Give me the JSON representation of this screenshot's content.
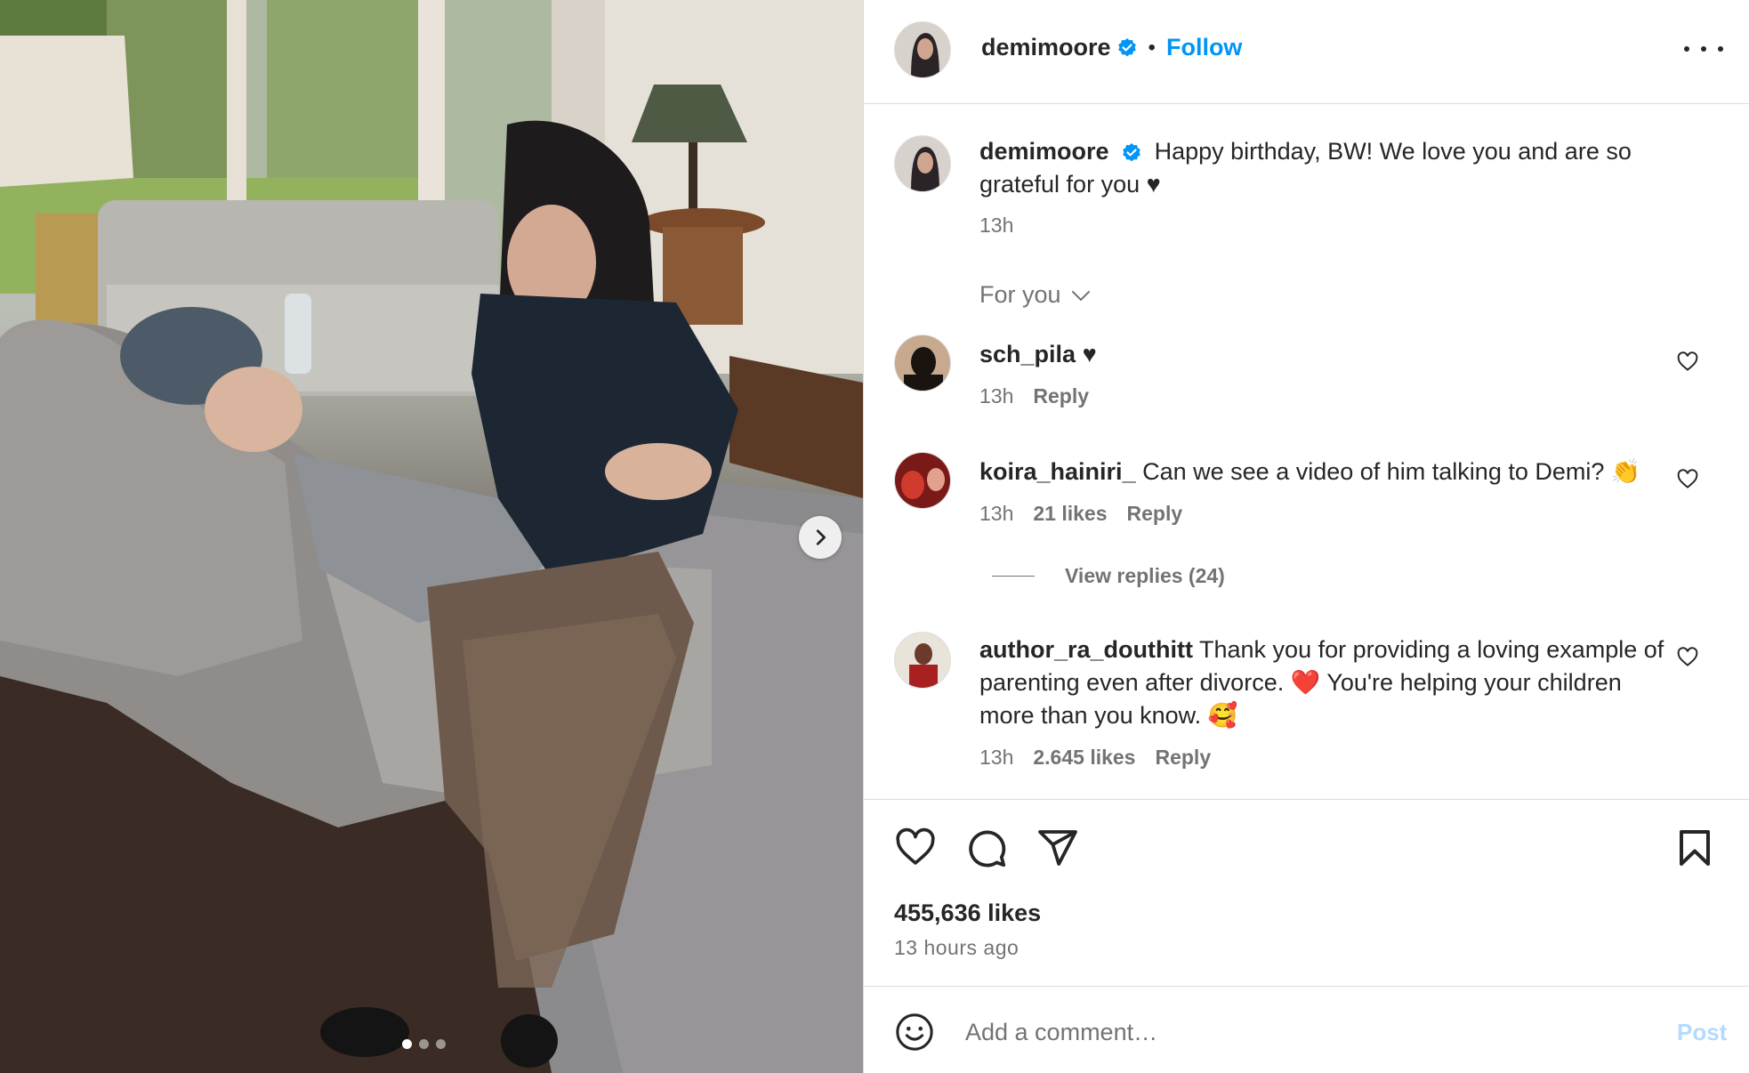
{
  "header": {
    "username": "demimoore",
    "separator": "•",
    "follow_label": "Follow"
  },
  "caption": {
    "username": "demimoore",
    "text": "Happy birthday, BW! We love you and are so grateful for you ♥",
    "time": "13h"
  },
  "filter": {
    "label": "For you"
  },
  "comments": [
    {
      "username": "sch_pila",
      "text": "♥",
      "time": "13h",
      "likes": "",
      "reply": "Reply"
    },
    {
      "username": "koira_hainiri_",
      "text": "Can we see a video of him talking to Demi? 👏",
      "time": "13h",
      "likes": "21 likes",
      "reply": "Reply",
      "view_replies": "View replies (24)"
    },
    {
      "username": "author_ra_douthitt",
      "text": "Thank you for providing a loving example of parenting even after divorce. ❤️ You're helping your children more than you know. 🥰",
      "time": "13h",
      "likes": "2.645 likes",
      "reply": "Reply"
    }
  ],
  "stats": {
    "likes": "455,636 likes",
    "time_ago": "13 hours ago"
  },
  "composer": {
    "placeholder": "Add a comment…",
    "post_label": "Post"
  },
  "carousel": {
    "slide_count": 3,
    "active_index": 0
  },
  "colors": {
    "accent": "#0095f6",
    "verified": "#0095f6",
    "post_disabled": "#b3dbff",
    "text": "#262626",
    "muted": "#737373"
  },
  "icons": [
    "chevron-right-icon",
    "verified-icon",
    "more-icon",
    "heart-icon",
    "comment-icon",
    "share-icon",
    "bookmark-icon",
    "emoji-icon",
    "chevron-down-icon"
  ]
}
